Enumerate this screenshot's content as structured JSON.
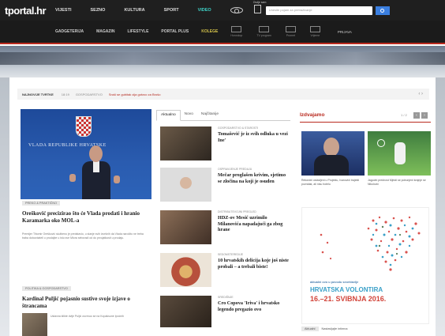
{
  "header": {
    "logo": "tportal.hr",
    "nav_primary": [
      "VIJESTI",
      "SEZNO",
      "KULTURA",
      "SPORT",
      "VIDEO"
    ],
    "mobile_label": "Ovdje sam",
    "search_placeholder": "Unesite pojam za pretraživanje",
    "nav_secondary": [
      "GADGETERIJA",
      "MAGAZIN",
      "LIFESTYLE",
      "PORTAL PLUS",
      "KOLEGE"
    ],
    "services": [
      "Horoskop",
      "TV program",
      "Promet",
      "Vrijeme"
    ],
    "login": "PRIJAVA",
    "accent_color": "#3fd2c7",
    "brand_red": "#b92a1f"
  },
  "ticker": {
    "label": "NAJNOVIJE TVRTKE",
    "time": "18:19",
    "category": "GOSPODARSTVO",
    "text": "Sruši se gubitak cija gotovo za Brošo",
    "nav": "‹ ›"
  },
  "lead_story": {
    "image_text": "VLADA REPUBLIKE HRVATSKE",
    "tag": "PREKO & PRAKTIČNO",
    "headline": "Orešković precizirao što će Vlada prodati i hranio Karamarka oko MOL-a",
    "lead": "Premijer Tihomir Orešković službeno je predstavio, u slanje svih izvršnih da Vlada naročito ne treba traba dotovotateli u prodajbe u istu sve Mlora seboradi od do prvojatkosti u prodaju."
  },
  "second_story": {
    "tag": "POLITIKA & GOSPODARSTVO",
    "headline": "Kardinal Puljić pojasnio sustive svoje izjave o štrancama",
    "snippet": "Ustavna klikte dvlje Puljić osvrnuo se na Kopaksune Ipoćnih"
  },
  "tabs": [
    "Aktualno",
    "Novo",
    "Najčitanije"
  ],
  "middle_items": [
    {
      "category": "GOSPODARSTVO & STAROSTI",
      "headline": "Tomašević je iz svih odluka u vezi Ine'"
    },
    {
      "category": "OSPRAVIJENJE PREDAJU",
      "headline": "Mečar proglašen krivim, sjetimo se zločina na koji je osuđen"
    },
    {
      "category": "DISTRIBUTEVOJNI PREGLED",
      "headline": "HDZ-ov Mesić uzrimilo Milanovića napadajući ga zbog hrane"
    },
    {
      "category": "SEDOMSTEREDIJE",
      "headline": "10 hrvatskih delicija koje još niste probali – a trebali biste!"
    },
    {
      "category": "SREDIŠNJE",
      "headline": "Cro Copova 'Iriva' i hrvatsko legendo pregazio ovo"
    }
  ],
  "right": {
    "title": "Izdvajamo",
    "pager": "1 / 2",
    "captions": [
      "Rekordni ostavljeni u Projektu, Ivanovići trajekti povratak, ali nisu hotelu",
      "Jagodni prednost Mjesti se pobunjeni krajnje se Nikolović"
    ],
    "ad_small": "aktualni ovo u povodu seorštavlje",
    "ad_big": "HRVATSKA VOLONTIRA",
    "ad_date": "16.–21. SVIBNJA 2016.",
    "tabs": [
      "Aktualni",
      "Nastavljajte intimna"
    ]
  }
}
